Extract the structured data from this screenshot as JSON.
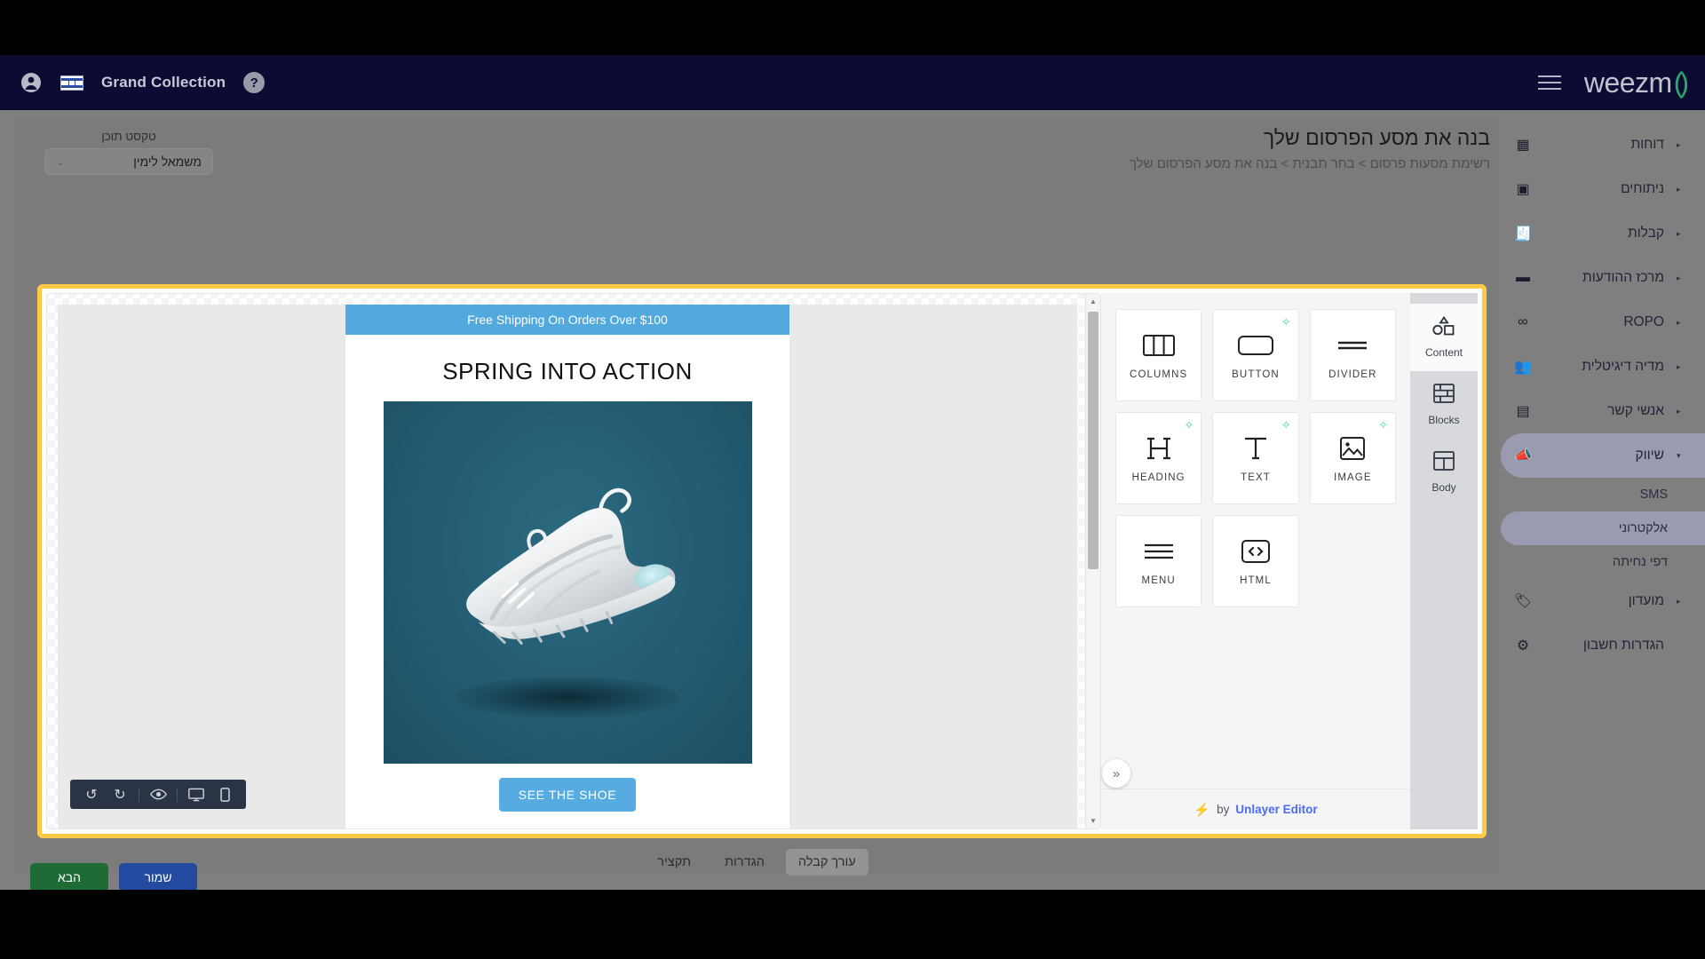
{
  "topbar": {
    "account_icon": "account-circle-icon",
    "flag_icon": "israel-flag-icon",
    "brand": "Grand Collection",
    "help_icon": "help-circle-icon",
    "menu_icon": "hamburger-menu-icon",
    "logo": "weezm",
    "logo_suffix": "()"
  },
  "page": {
    "title": "בנה את מסע הפרסום שלך",
    "breadcrumb": "רשימת מסעות פרסום  >  בחר תבנית  >  בנה את מסע הפרסום שלך"
  },
  "direction_dropdown": {
    "label": "טקסט תוכן",
    "value": "משמאל לימין",
    "caret": "chevron-down-icon"
  },
  "sidebar": {
    "items": [
      {
        "label": "דוחות",
        "icon": "dashboard-icon",
        "arrow": "▸",
        "active": false
      },
      {
        "label": "ניתוחים",
        "icon": "analytics-icon",
        "arrow": "▸",
        "active": false
      },
      {
        "label": "קבלות",
        "icon": "receipt-icon",
        "arrow": "▸",
        "active": false
      },
      {
        "label": "מרכז ההודעות",
        "icon": "message-icon",
        "arrow": "▸",
        "active": false
      },
      {
        "label": "ROPO",
        "icon": "infinity-icon",
        "arrow": "▸",
        "active": false
      },
      {
        "label": "מדיה דיגיטלית",
        "icon": "people-icon",
        "arrow": "▸",
        "active": false
      },
      {
        "label": "אנשי קשר",
        "icon": "contacts-icon",
        "arrow": "▸",
        "active": false
      },
      {
        "label": "שיווק",
        "icon": "megaphone-icon",
        "arrow": "▾",
        "active": true
      }
    ],
    "sub_items": [
      {
        "label": "SMS",
        "active": false
      },
      {
        "label": "אלקטרוני",
        "active": true
      },
      {
        "label": "דפי נחיתה",
        "active": false
      }
    ],
    "tail_items": [
      {
        "label": "מועדון",
        "icon": "tag-icon",
        "arrow": "▸",
        "active": false
      },
      {
        "label": "הגדרות חשבון",
        "icon": "gear-icon",
        "arrow": "",
        "active": false
      }
    ]
  },
  "editor": {
    "toolbar": [
      {
        "name": "undo-icon",
        "glyph": "↺"
      },
      {
        "name": "redo-icon",
        "glyph": "↻"
      },
      {
        "name": "preview-eye-icon",
        "glyph": "◉"
      },
      {
        "name": "desktop-view-icon",
        "glyph": "🖵"
      },
      {
        "name": "mobile-view-icon",
        "glyph": "▯"
      }
    ],
    "collapse_icon": "»",
    "scroll_up_icon": "▲",
    "scroll_down_icon": "▼"
  },
  "email": {
    "promo_bar": "Free Shipping On Orders Over $100",
    "heading": "SPRING INTO ACTION",
    "hero_image": "white-sneaker-on-teal-background",
    "cta_label": "SEE THE SHOE",
    "promo_bar_color": "#52a9dd",
    "cta_color": "#56ace0"
  },
  "tool_panel": {
    "blocks": [
      {
        "name": "COLUMNS",
        "icon": "columns-icon",
        "ai": false
      },
      {
        "name": "BUTTON",
        "icon": "button-icon",
        "ai": true
      },
      {
        "name": "DIVIDER",
        "icon": "divider-icon",
        "ai": false
      },
      {
        "name": "HEADING",
        "icon": "heading-icon",
        "ai": true
      },
      {
        "name": "TEXT",
        "icon": "text-icon",
        "ai": true
      },
      {
        "name": "IMAGE",
        "icon": "image-icon",
        "ai": true
      },
      {
        "name": "MENU",
        "icon": "menu-icon",
        "ai": false
      },
      {
        "name": "HTML",
        "icon": "html-code-icon",
        "ai": false
      }
    ],
    "tabs": [
      {
        "label": "Content",
        "icon": "shapes-icon",
        "active": true
      },
      {
        "label": "Blocks",
        "icon": "bricks-icon",
        "active": false
      },
      {
        "label": "Body",
        "icon": "layout-icon",
        "active": false
      }
    ],
    "footer": {
      "by": "by",
      "link": "Unlayer Editor",
      "bolt": "⚡"
    },
    "ai_badge": "✧"
  },
  "bottom": {
    "tabs": [
      {
        "label": "עורך קבלה",
        "active": true
      },
      {
        "label": "הגדרות",
        "active": false
      },
      {
        "label": "תקציר",
        "active": false
      }
    ],
    "buttons": [
      {
        "label": "הבא",
        "style": "primary",
        "color": "#1f6b36"
      },
      {
        "label": "שמור",
        "style": "secondary",
        "color": "#234a9e"
      }
    ]
  }
}
